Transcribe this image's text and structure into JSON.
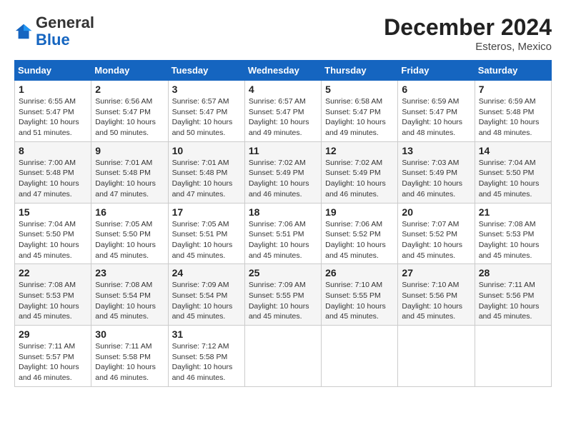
{
  "header": {
    "logo_general": "General",
    "logo_blue": "Blue",
    "month_title": "December 2024",
    "location": "Esteros, Mexico"
  },
  "weekdays": [
    "Sunday",
    "Monday",
    "Tuesday",
    "Wednesday",
    "Thursday",
    "Friday",
    "Saturday"
  ],
  "weeks": [
    [
      {
        "day": "1",
        "sunrise": "6:55 AM",
        "sunset": "5:47 PM",
        "daylight": "10 hours and 51 minutes."
      },
      {
        "day": "2",
        "sunrise": "6:56 AM",
        "sunset": "5:47 PM",
        "daylight": "10 hours and 50 minutes."
      },
      {
        "day": "3",
        "sunrise": "6:57 AM",
        "sunset": "5:47 PM",
        "daylight": "10 hours and 50 minutes."
      },
      {
        "day": "4",
        "sunrise": "6:57 AM",
        "sunset": "5:47 PM",
        "daylight": "10 hours and 49 minutes."
      },
      {
        "day": "5",
        "sunrise": "6:58 AM",
        "sunset": "5:47 PM",
        "daylight": "10 hours and 49 minutes."
      },
      {
        "day": "6",
        "sunrise": "6:59 AM",
        "sunset": "5:47 PM",
        "daylight": "10 hours and 48 minutes."
      },
      {
        "day": "7",
        "sunrise": "6:59 AM",
        "sunset": "5:48 PM",
        "daylight": "10 hours and 48 minutes."
      }
    ],
    [
      {
        "day": "8",
        "sunrise": "7:00 AM",
        "sunset": "5:48 PM",
        "daylight": "10 hours and 47 minutes."
      },
      {
        "day": "9",
        "sunrise": "7:01 AM",
        "sunset": "5:48 PM",
        "daylight": "10 hours and 47 minutes."
      },
      {
        "day": "10",
        "sunrise": "7:01 AM",
        "sunset": "5:48 PM",
        "daylight": "10 hours and 47 minutes."
      },
      {
        "day": "11",
        "sunrise": "7:02 AM",
        "sunset": "5:49 PM",
        "daylight": "10 hours and 46 minutes."
      },
      {
        "day": "12",
        "sunrise": "7:02 AM",
        "sunset": "5:49 PM",
        "daylight": "10 hours and 46 minutes."
      },
      {
        "day": "13",
        "sunrise": "7:03 AM",
        "sunset": "5:49 PM",
        "daylight": "10 hours and 46 minutes."
      },
      {
        "day": "14",
        "sunrise": "7:04 AM",
        "sunset": "5:50 PM",
        "daylight": "10 hours and 45 minutes."
      }
    ],
    [
      {
        "day": "15",
        "sunrise": "7:04 AM",
        "sunset": "5:50 PM",
        "daylight": "10 hours and 45 minutes."
      },
      {
        "day": "16",
        "sunrise": "7:05 AM",
        "sunset": "5:50 PM",
        "daylight": "10 hours and 45 minutes."
      },
      {
        "day": "17",
        "sunrise": "7:05 AM",
        "sunset": "5:51 PM",
        "daylight": "10 hours and 45 minutes."
      },
      {
        "day": "18",
        "sunrise": "7:06 AM",
        "sunset": "5:51 PM",
        "daylight": "10 hours and 45 minutes."
      },
      {
        "day": "19",
        "sunrise": "7:06 AM",
        "sunset": "5:52 PM",
        "daylight": "10 hours and 45 minutes."
      },
      {
        "day": "20",
        "sunrise": "7:07 AM",
        "sunset": "5:52 PM",
        "daylight": "10 hours and 45 minutes."
      },
      {
        "day": "21",
        "sunrise": "7:08 AM",
        "sunset": "5:53 PM",
        "daylight": "10 hours and 45 minutes."
      }
    ],
    [
      {
        "day": "22",
        "sunrise": "7:08 AM",
        "sunset": "5:53 PM",
        "daylight": "10 hours and 45 minutes."
      },
      {
        "day": "23",
        "sunrise": "7:08 AM",
        "sunset": "5:54 PM",
        "daylight": "10 hours and 45 minutes."
      },
      {
        "day": "24",
        "sunrise": "7:09 AM",
        "sunset": "5:54 PM",
        "daylight": "10 hours and 45 minutes."
      },
      {
        "day": "25",
        "sunrise": "7:09 AM",
        "sunset": "5:55 PM",
        "daylight": "10 hours and 45 minutes."
      },
      {
        "day": "26",
        "sunrise": "7:10 AM",
        "sunset": "5:55 PM",
        "daylight": "10 hours and 45 minutes."
      },
      {
        "day": "27",
        "sunrise": "7:10 AM",
        "sunset": "5:56 PM",
        "daylight": "10 hours and 45 minutes."
      },
      {
        "day": "28",
        "sunrise": "7:11 AM",
        "sunset": "5:56 PM",
        "daylight": "10 hours and 45 minutes."
      }
    ],
    [
      {
        "day": "29",
        "sunrise": "7:11 AM",
        "sunset": "5:57 PM",
        "daylight": "10 hours and 46 minutes."
      },
      {
        "day": "30",
        "sunrise": "7:11 AM",
        "sunset": "5:58 PM",
        "daylight": "10 hours and 46 minutes."
      },
      {
        "day": "31",
        "sunrise": "7:12 AM",
        "sunset": "5:58 PM",
        "daylight": "10 hours and 46 minutes."
      },
      null,
      null,
      null,
      null
    ]
  ],
  "labels": {
    "sunrise": "Sunrise: ",
    "sunset": "Sunset: ",
    "daylight": "Daylight: "
  }
}
